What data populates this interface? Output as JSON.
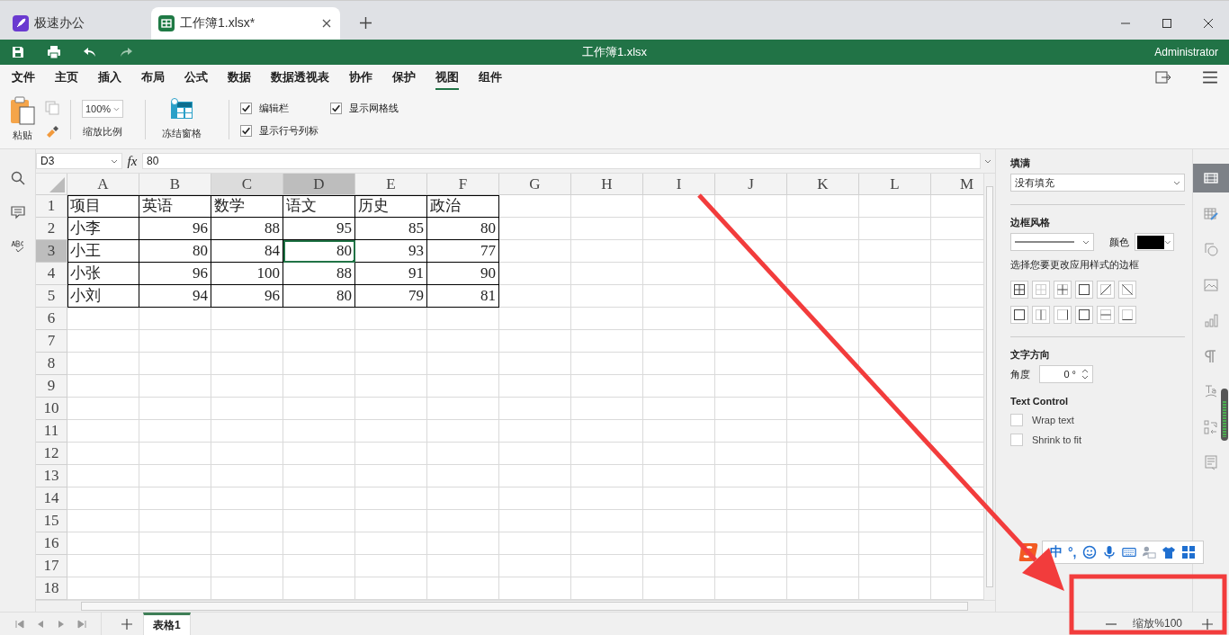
{
  "browser_tabs": [
    {
      "label": "极速办公",
      "kind": "app",
      "selected": false
    },
    {
      "label": "工作簿1.xlsx*",
      "kind": "sheet",
      "selected": true
    }
  ],
  "title_bar": {
    "title": "工作簿1.xlsx",
    "user": "Administrator"
  },
  "menu": [
    {
      "label": "文件",
      "selected": false
    },
    {
      "label": "主页",
      "selected": false
    },
    {
      "label": "插入",
      "selected": false
    },
    {
      "label": "布局",
      "selected": false
    },
    {
      "label": "公式",
      "selected": false
    },
    {
      "label": "数据",
      "selected": false
    },
    {
      "label": "数据透视表",
      "selected": false
    },
    {
      "label": "协作",
      "selected": false
    },
    {
      "label": "保护",
      "selected": false
    },
    {
      "label": "视图",
      "selected": true
    },
    {
      "label": "组件",
      "selected": false
    }
  ],
  "ribbon": {
    "paste": "粘贴",
    "zoom_value": "100%",
    "zoom_label": "缩放比例",
    "freeze": "冻结窗格",
    "options": [
      {
        "label": "编辑栏",
        "checked": true
      },
      {
        "label": "显示网格线",
        "checked": true
      },
      {
        "label": "显示行号列标",
        "checked": true
      }
    ]
  },
  "formula_bar": {
    "cell": "D3",
    "fx": "fx",
    "value": "80"
  },
  "columns": [
    {
      "label": "A",
      "selected": false,
      "hovered": false
    },
    {
      "label": "B",
      "selected": false,
      "hovered": false
    },
    {
      "label": "C",
      "selected": false,
      "hovered": true
    },
    {
      "label": "D",
      "selected": true,
      "hovered": false
    },
    {
      "label": "E",
      "selected": false,
      "hovered": false
    },
    {
      "label": "F",
      "selected": false,
      "hovered": false
    },
    {
      "label": "G",
      "selected": false,
      "hovered": false
    },
    {
      "label": "H",
      "selected": false,
      "hovered": false
    },
    {
      "label": "I",
      "selected": false,
      "hovered": false
    },
    {
      "label": "J",
      "selected": false,
      "hovered": false
    },
    {
      "label": "K",
      "selected": false,
      "hovered": false
    },
    {
      "label": "L",
      "selected": false,
      "hovered": false
    },
    {
      "label": "M",
      "selected": false,
      "hovered": false
    }
  ],
  "rows": [
    {
      "header": "1",
      "selected": false,
      "cells": [
        {
          "text": "项目",
          "kind": "text",
          "selected": false
        },
        {
          "text": "英语",
          "kind": "text",
          "selected": false
        },
        {
          "text": "数学",
          "kind": "text",
          "selected": false
        },
        {
          "text": "语文",
          "kind": "text",
          "selected": false
        },
        {
          "text": "历史",
          "kind": "text",
          "selected": false
        },
        {
          "text": "政治",
          "kind": "text",
          "selected": false
        }
      ]
    },
    {
      "header": "2",
      "selected": false,
      "cells": [
        {
          "text": "小李",
          "kind": "text",
          "selected": false
        },
        {
          "text": "96",
          "kind": "number",
          "selected": false
        },
        {
          "text": "88",
          "kind": "number",
          "selected": false
        },
        {
          "text": "95",
          "kind": "number",
          "selected": false
        },
        {
          "text": "85",
          "kind": "number",
          "selected": false
        },
        {
          "text": "80",
          "kind": "number",
          "selected": false
        }
      ]
    },
    {
      "header": "3",
      "selected": true,
      "cells": [
        {
          "text": "小王",
          "kind": "text",
          "selected": false
        },
        {
          "text": "80",
          "kind": "number",
          "selected": false
        },
        {
          "text": "84",
          "kind": "number",
          "selected": false
        },
        {
          "text": "80",
          "kind": "number",
          "selected": true
        },
        {
          "text": "93",
          "kind": "number",
          "selected": false
        },
        {
          "text": "77",
          "kind": "number",
          "selected": false
        }
      ]
    },
    {
      "header": "4",
      "selected": false,
      "cells": [
        {
          "text": "小张",
          "kind": "text",
          "selected": false
        },
        {
          "text": "96",
          "kind": "number",
          "selected": false
        },
        {
          "text": "100",
          "kind": "number",
          "selected": false
        },
        {
          "text": "88",
          "kind": "number",
          "selected": false
        },
        {
          "text": "91",
          "kind": "number",
          "selected": false
        },
        {
          "text": "90",
          "kind": "number",
          "selected": false
        }
      ]
    },
    {
      "header": "5",
      "selected": false,
      "cells": [
        {
          "text": "小刘",
          "kind": "text",
          "selected": false
        },
        {
          "text": "94",
          "kind": "number",
          "selected": false
        },
        {
          "text": "96",
          "kind": "number",
          "selected": false
        },
        {
          "text": "80",
          "kind": "number",
          "selected": false
        },
        {
          "text": "79",
          "kind": "number",
          "selected": false
        },
        {
          "text": "81",
          "kind": "number",
          "selected": false
        }
      ]
    },
    {
      "header": "6",
      "selected": false
    },
    {
      "header": "7",
      "selected": false
    },
    {
      "header": "8",
      "selected": false
    },
    {
      "header": "9",
      "selected": false
    },
    {
      "header": "10",
      "selected": false
    },
    {
      "header": "11",
      "selected": false
    },
    {
      "header": "12",
      "selected": false
    },
    {
      "header": "13",
      "selected": false
    },
    {
      "header": "14",
      "selected": false
    },
    {
      "header": "15",
      "selected": false
    },
    {
      "header": "16",
      "selected": false
    },
    {
      "header": "17",
      "selected": false
    },
    {
      "header": "18",
      "selected": false
    }
  ],
  "format_panel": {
    "fill_title": "填满",
    "fill_value": "没有填充",
    "border_title": "边框风格",
    "color_label": "颜色",
    "border_hint": "选择您要更改应用样式的边框",
    "direction_title": "文字方向",
    "angle_label": "角度",
    "angle_value": "0 °",
    "text_control_title": "Text Control",
    "text_options": [
      {
        "label": "Wrap text",
        "checked": false
      },
      {
        "label": "Shrink to fit",
        "checked": false
      }
    ]
  },
  "side_icons": [
    {
      "kind": "cell",
      "selected": true
    },
    {
      "kind": "table",
      "selected": false
    },
    {
      "kind": "shape",
      "selected": false
    },
    {
      "kind": "image",
      "selected": false
    },
    {
      "kind": "chart",
      "selected": false
    },
    {
      "kind": "paragraph",
      "selected": false
    },
    {
      "kind": "textart",
      "selected": false
    },
    {
      "kind": "swap",
      "selected": false
    },
    {
      "kind": "comment",
      "selected": false
    }
  ],
  "ime": {
    "mode": "中",
    "punct": "°,"
  },
  "sheets": [
    {
      "label": "表格1",
      "selected": true
    }
  ],
  "zoom_label": "缩放%100"
}
